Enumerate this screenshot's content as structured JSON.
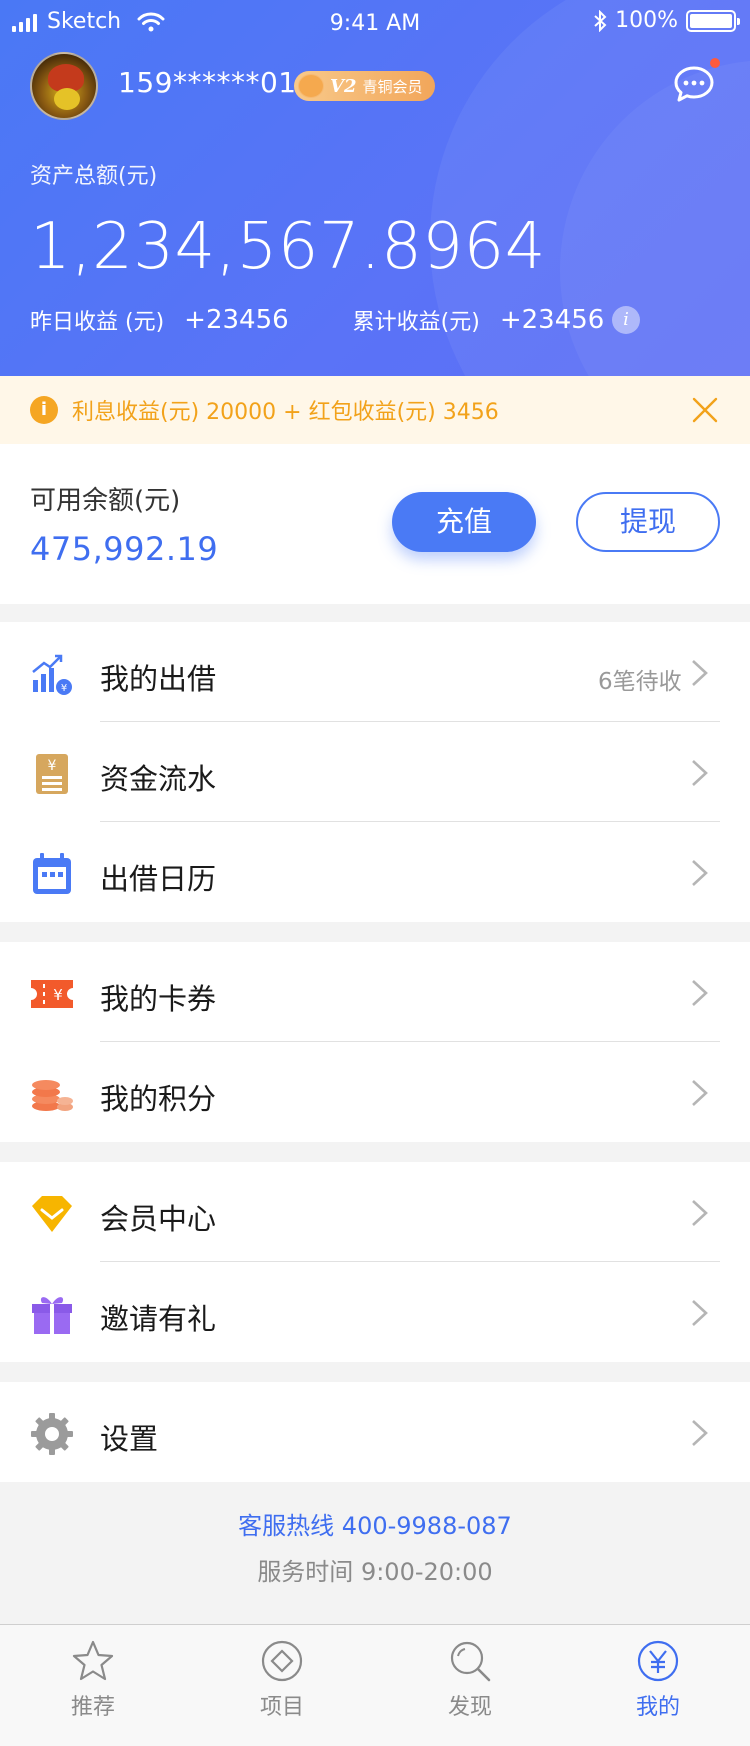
{
  "status_bar": {
    "carrier": "Sketch",
    "time": "9:41 AM",
    "battery": "100%"
  },
  "profile": {
    "phone": "159******01",
    "vip_level": "V2",
    "vip_name": "青铜会员"
  },
  "assets": {
    "total_label": "资产总额(元)",
    "total_value": "1,234,567.8964",
    "yesterday_label": "昨日收益 (元)",
    "yesterday_value": "+23456",
    "cumulative_label": "累计收益(元)",
    "cumulative_value": "+23456",
    "info_glyph": "i"
  },
  "notice": {
    "icon": "i",
    "text": "利息收益(元)  20000 + 红包收益(元)  3456"
  },
  "balance": {
    "label": "可用余额(元)",
    "value": "475,992.19",
    "recharge_label": "充值",
    "withdraw_label": "提现"
  },
  "menu": {
    "group1": [
      {
        "label": "我的出借",
        "extra": "6笔待收",
        "icon": "chart-up-icon"
      },
      {
        "label": "资金流水",
        "extra": "",
        "icon": "ledger-icon"
      },
      {
        "label": "出借日历",
        "extra": "",
        "icon": "calendar-icon"
      }
    ],
    "group2": [
      {
        "label": "我的卡券",
        "extra": "",
        "icon": "coupon-icon"
      },
      {
        "label": "我的积分",
        "extra": "",
        "icon": "coins-icon"
      }
    ],
    "group3": [
      {
        "label": "会员中心",
        "extra": "",
        "icon": "diamond-icon"
      },
      {
        "label": "邀请有礼",
        "extra": "",
        "icon": "gift-icon"
      }
    ],
    "group4": [
      {
        "label": "设置",
        "extra": "",
        "icon": "gear-icon"
      }
    ]
  },
  "footer": {
    "hotline": "客服热线 400-9988-087",
    "service_hours": "服务时间 9:00-20:00"
  },
  "tabbar": [
    {
      "label": "推荐",
      "icon": "star-icon"
    },
    {
      "label": "项目",
      "icon": "diamond-circle-icon"
    },
    {
      "label": "发现",
      "icon": "search-icon"
    },
    {
      "label": "我的",
      "icon": "yuan-circle-icon",
      "active": true
    }
  ],
  "colors": {
    "primary": "#4a7af5",
    "warning": "#f5a623",
    "vip": "#f2a65a"
  }
}
